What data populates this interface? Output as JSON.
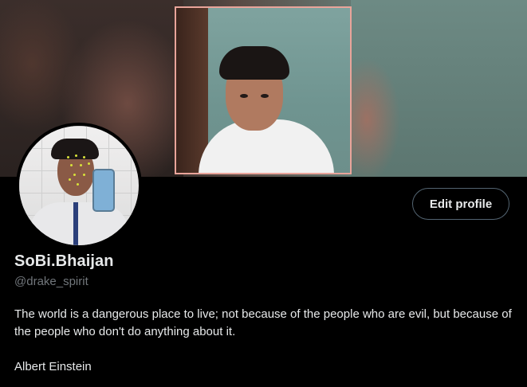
{
  "profile": {
    "display_name": "SoBi.Bhaijan",
    "handle": "@drake_spirit",
    "bio_line_1": "The world is a dangerous place to live; not because of the people who are evil, but because of the people who don't do anything about it.",
    "bio_author": "Albert Einstein",
    "edit_profile_label": "Edit profile"
  },
  "colors": {
    "background": "#000000",
    "primary_text": "#e7e9ea",
    "secondary_text": "#71767b",
    "button_border": "#536471"
  }
}
